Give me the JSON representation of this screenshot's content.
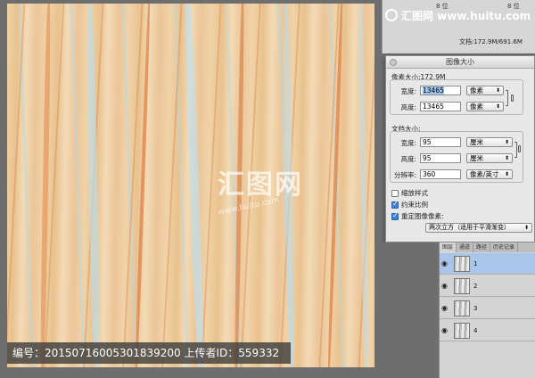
{
  "watermark": {
    "site_logo": "汇图网 www.huitu.com",
    "center_big": "汇图网",
    "center_small": "www.huitu.com"
  },
  "info_panel": {
    "r1": "8 位",
    "r2": "8 位",
    "doc_size": "文档:172.9M/691.6M"
  },
  "dialog": {
    "title": "图像大小",
    "pixel_dimensions_label": "像素大小:172.9M",
    "width_label": "宽度:",
    "width_value": "13465",
    "width_unit": "像素",
    "height_label": "高度:",
    "height_value": "13465",
    "height_unit": "像素",
    "document_size_label": "文档大小:",
    "doc_width_label": "宽度:",
    "doc_width_value": "95",
    "doc_width_unit": "厘米",
    "doc_height_label": "高度:",
    "doc_height_value": "95",
    "doc_height_unit": "厘米",
    "resolution_label": "分辨率:",
    "resolution_value": "360",
    "resolution_unit": "像素/英寸",
    "scale_styles": "缩放样式",
    "constrain_proportions": "约束比例",
    "resample": "重定图像像素:",
    "resample_method": "两次立方（适用于平滑渐变）"
  },
  "layers": {
    "tabs": [
      "图层",
      "通道",
      "路径",
      "历史记录"
    ],
    "rows": [
      {
        "name": "1",
        "selected": true
      },
      {
        "name": "2",
        "selected": false
      },
      {
        "name": "3",
        "selected": false
      },
      {
        "name": "4",
        "selected": false
      }
    ]
  },
  "caption": "编号：20150716005301839200 上传者ID：559332",
  "colors": {
    "accent": "#3b80d9",
    "selected_layer": "#a9c6ea"
  }
}
